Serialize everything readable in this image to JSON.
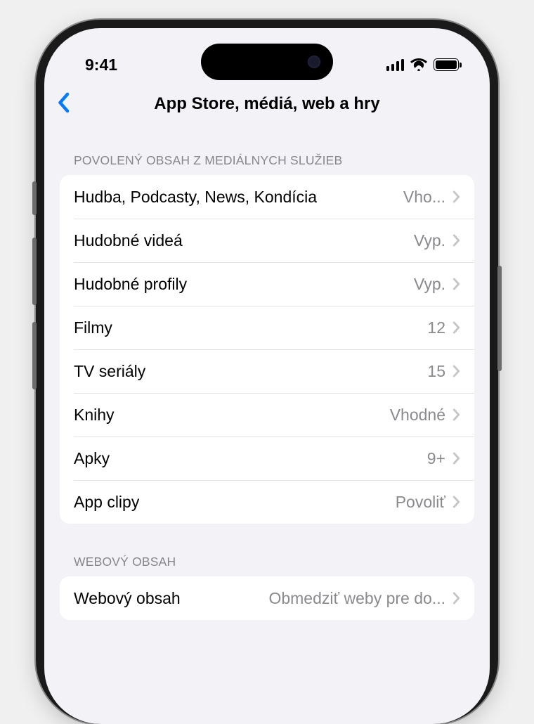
{
  "status": {
    "time": "9:41"
  },
  "nav": {
    "title": "App Store, médiá, web a hry"
  },
  "sections": {
    "media": {
      "header": "POVOLENÝ OBSAH Z MEDIÁLNYCH SLUŽIEB",
      "rows": [
        {
          "label": "Hudba, Podcasty, News, Kondícia",
          "value": "Vho..."
        },
        {
          "label": "Hudobné videá",
          "value": "Vyp."
        },
        {
          "label": "Hudobné profily",
          "value": "Vyp."
        },
        {
          "label": "Filmy",
          "value": "12"
        },
        {
          "label": "TV seriály",
          "value": "15"
        },
        {
          "label": "Knihy",
          "value": "Vhodné"
        },
        {
          "label": "Apky",
          "value": "9+"
        },
        {
          "label": "App clipy",
          "value": "Povoliť"
        }
      ]
    },
    "web": {
      "header": "WEBOVÝ OBSAH",
      "rows": [
        {
          "label": "Webový obsah",
          "value": "Obmedziť weby pre do..."
        }
      ]
    }
  }
}
